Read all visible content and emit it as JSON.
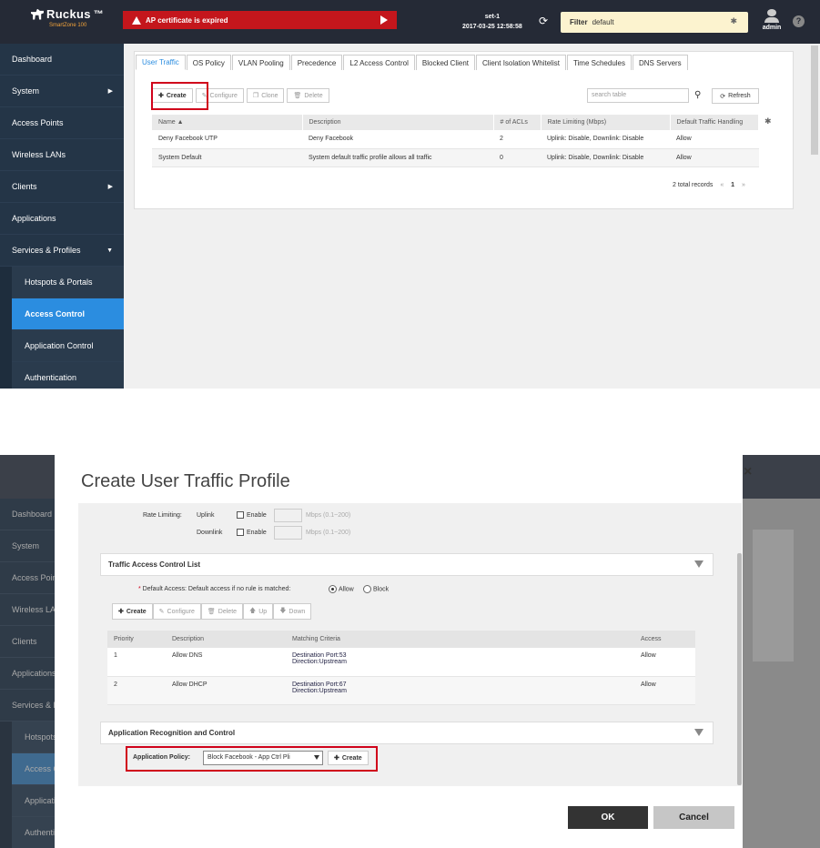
{
  "brand": {
    "name": "Ruckus",
    "tm": "™",
    "product": "SmartZone 100"
  },
  "alert": {
    "text": "AP certificate is expired"
  },
  "system": {
    "name": "set-1",
    "datetime": "2017-03-25  12:58:58"
  },
  "filter": {
    "label": "Filter",
    "value": "default"
  },
  "user": {
    "name": "admin"
  },
  "help": {
    "symbol": "?"
  },
  "sidebar": {
    "items": [
      {
        "label": "Dashboard"
      },
      {
        "label": "System"
      },
      {
        "label": "Access Points"
      },
      {
        "label": "Wireless LANs"
      },
      {
        "label": "Clients"
      },
      {
        "label": "Applications"
      },
      {
        "label": "Services & Profiles"
      }
    ],
    "sub_items": [
      {
        "label": "Hotspots & Portals"
      },
      {
        "label": "Access Control"
      },
      {
        "label": "Application Control"
      },
      {
        "label": "Authentication"
      }
    ]
  },
  "tabs": [
    "User Traffic",
    "OS Policy",
    "VLAN Pooling",
    "Precedence",
    "L2 Access Control",
    "Blocked Client",
    "Client Isolation Whitelist",
    "Time Schedules",
    "DNS Servers"
  ],
  "toolbar": {
    "create": "Create",
    "configure": "Configure",
    "clone": "Clone",
    "delete": "Delete"
  },
  "search": {
    "placeholder": "search table"
  },
  "refresh_label": "Refresh",
  "table1": {
    "headers": [
      "Name ▲",
      "Description",
      "# of ACLs",
      "Rate Limiting (Mbps)",
      "Default Traffic Handling"
    ],
    "rows": [
      [
        "Deny Facebook UTP",
        "Deny Facebook",
        "2",
        "Uplink: Disable, Downlink: Disable",
        "Allow"
      ],
      [
        "System Default",
        "System default traffic profile allows all traffic",
        "0",
        "Uplink: Disable, Downlink: Disable",
        "Allow"
      ]
    ]
  },
  "pager": {
    "total": "2 total records",
    "prev": "«",
    "page": "1",
    "next": "»"
  },
  "dialog": {
    "title": "Create User Traffic Profile",
    "close": "×",
    "rate_limiting_label": "Rate Limiting:",
    "uplink_label": "Uplink",
    "downlink_label": "Downlink",
    "enable_label": "Enable",
    "mbps_hint": "Mbps (0.1~200)",
    "acl_section": "Traffic Access Control List",
    "default_access_label": "Default Access:",
    "default_access_text": "Default access if no rule is matched:",
    "allow": "Allow",
    "block": "Block",
    "acl_toolbar": {
      "create": "Create",
      "configure": "Configure",
      "delete": "Delete",
      "up": "Up",
      "down": "Down"
    },
    "acl_table": {
      "headers": [
        "Priority",
        "Description",
        "Matching Criteria",
        "Access"
      ],
      "rows": [
        {
          "priority": "1",
          "description": "Allow DNS",
          "criteria1": "Destination Port:53",
          "criteria2": "Direction:Upstream",
          "access": "Allow"
        },
        {
          "priority": "2",
          "description": "Allow DHCP",
          "criteria1": "Destination Port:67",
          "criteria2": "Direction:Upstream",
          "access": "Allow"
        }
      ]
    },
    "arc_section": "Application Recognition and Control",
    "app_policy_label": "Application Policy:",
    "app_policy_value": "Block Facebook - App Ctrl Pli",
    "app_create": "Create",
    "ok": "OK",
    "cancel": "Cancel"
  },
  "colors": {
    "accent": "#2b8de0",
    "highlight": "#d0021b",
    "alert": "#c4161c",
    "topbar": "#252a36"
  }
}
